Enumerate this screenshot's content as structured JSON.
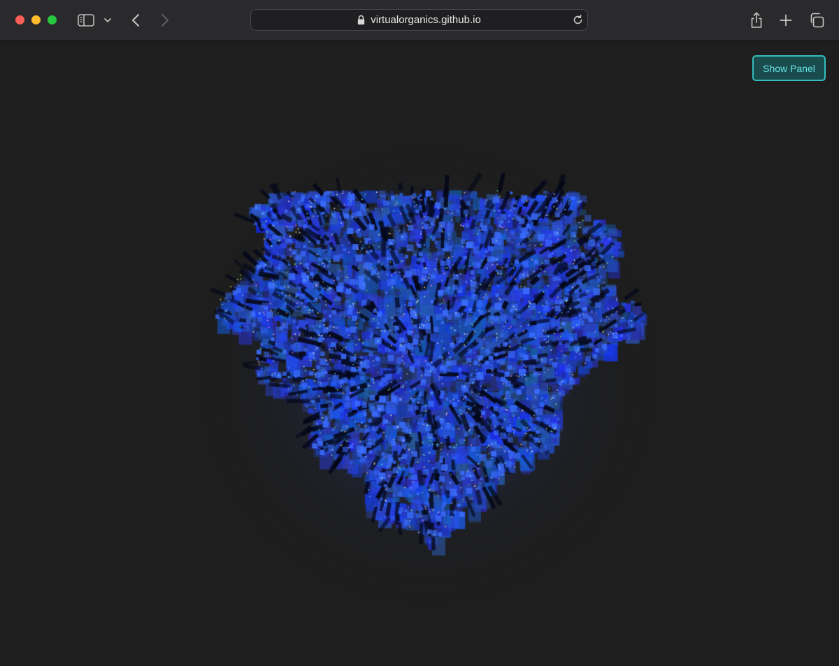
{
  "browser": {
    "url": "virtualorganics.github.io",
    "icons": {
      "sidebar": "sidebar-icon",
      "chevron": "chevron-down-icon",
      "back": "back-arrow-icon",
      "forward": "forward-arrow-icon",
      "lock": "lock-icon",
      "reload": "reload-icon",
      "share": "share-icon",
      "new_tab": "plus-icon",
      "tab_overview": "tab-overview-icon"
    },
    "colors": {
      "close": "#fe5f57",
      "minimize": "#febc2e",
      "maximize": "#28c840"
    }
  },
  "page": {
    "show_panel_label": "Show Panel",
    "visual": "3D voxel organism rendered in blue with scattered glowing particles",
    "colors": {
      "background": "#1e1e1e",
      "organism_blue": "#2f5fe0",
      "button_border": "#33bdbd",
      "button_text": "#66e3e6"
    }
  }
}
